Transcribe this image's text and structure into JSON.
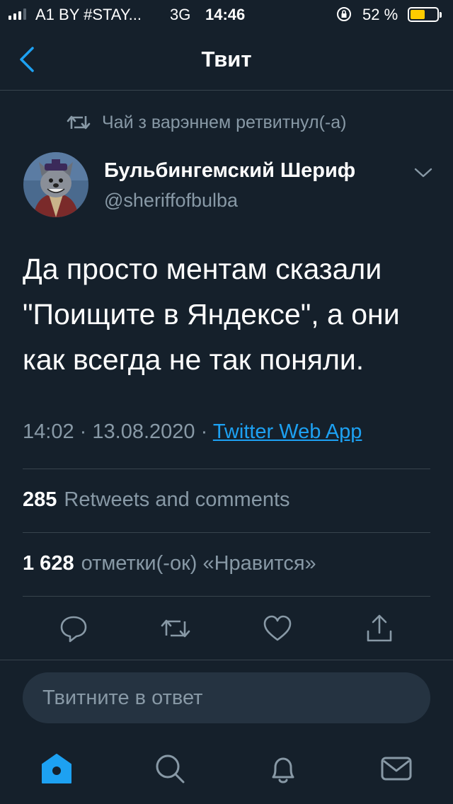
{
  "status_bar": {
    "carrier": "A1 BY #STAY...",
    "network": "3G",
    "time": "14:46",
    "battery_percent": "52 %",
    "battery_level": 0.52
  },
  "header": {
    "title": "Твит",
    "back_icon": "chevron-left-icon"
  },
  "tweet": {
    "retweet_context": "Чай з варэннем ретвитнул(-а)",
    "author_name": "Бульбингемский Шериф",
    "author_handle": "@sheriffofbulba",
    "text": "Да просто ментам сказали \"Поищите в Яндексе\", а они как всегда не так поняли.",
    "time": "14:02",
    "separator": "·",
    "date": "13.08.2020",
    "source": "Twitter Web App",
    "retweets_count": "285",
    "retweets_label": "Retweets and comments",
    "likes_count": "1 628",
    "likes_label": "отметки(-ок) «Нравится»"
  },
  "actions": [
    "reply-icon",
    "retweet-icon",
    "like-icon",
    "share-icon"
  ],
  "reply": {
    "placeholder": "Твитните в ответ"
  },
  "tab_bar": [
    "home-icon",
    "search-icon",
    "notifications-icon",
    "messages-icon"
  ],
  "colors": {
    "background": "#15202b",
    "accent": "#1da1f2",
    "secondary_text": "#8899a6",
    "divider": "#38444d",
    "battery": "#ffcc00"
  }
}
